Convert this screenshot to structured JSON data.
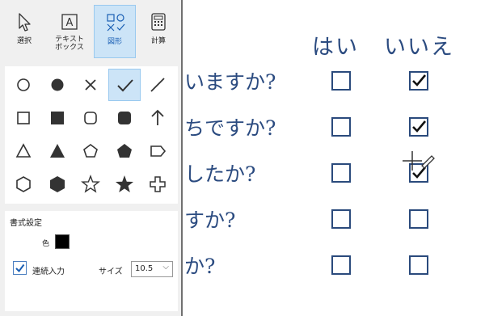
{
  "toolbar": {
    "tools": [
      {
        "label": "選択",
        "icon": "pointer-icon"
      },
      {
        "label": "テキスト\nボックス",
        "icon": "text-box-icon"
      },
      {
        "label": "図形",
        "icon": "shapes-icon",
        "active": true
      },
      {
        "label": "計算",
        "icon": "calculator-icon"
      }
    ]
  },
  "shapes": [
    "circle-outline-icon",
    "circle-filled-icon",
    "cross-icon",
    "checkmark-icon",
    "line-icon",
    "square-outline-icon",
    "square-filled-icon",
    "rounded-square-outline-icon",
    "rounded-square-filled-icon",
    "arrow-up-icon",
    "triangle-outline-icon",
    "triangle-filled-icon",
    "pentagon-outline-icon",
    "pentagon-filled-icon",
    "tag-outline-icon",
    "hexagon-outline-icon",
    "hexagon-filled-icon",
    "star-outline-icon",
    "star-filled-icon",
    "plus-outline-icon"
  ],
  "selected_shape": "checkmark-icon",
  "format": {
    "title": "書式設定",
    "color_label": "色",
    "color_value": "#000000",
    "continuous_label": "連続入力",
    "continuous_checked": true,
    "size_label": "サイズ",
    "size_value": "10.5"
  },
  "document": {
    "header_yes": "はい",
    "header_no": "いいえ",
    "rows": [
      {
        "question": "いますか?",
        "yes": false,
        "no": true
      },
      {
        "question": "ちですか?",
        "yes": false,
        "no": true
      },
      {
        "question": "したか?",
        "yes": false,
        "no": true
      },
      {
        "question": "すか?",
        "yes": false,
        "no": false
      },
      {
        "question": "か?",
        "yes": false,
        "no": false
      }
    ]
  },
  "colors": {
    "accent": "#cce4f7",
    "ink": "#2b4b80"
  }
}
